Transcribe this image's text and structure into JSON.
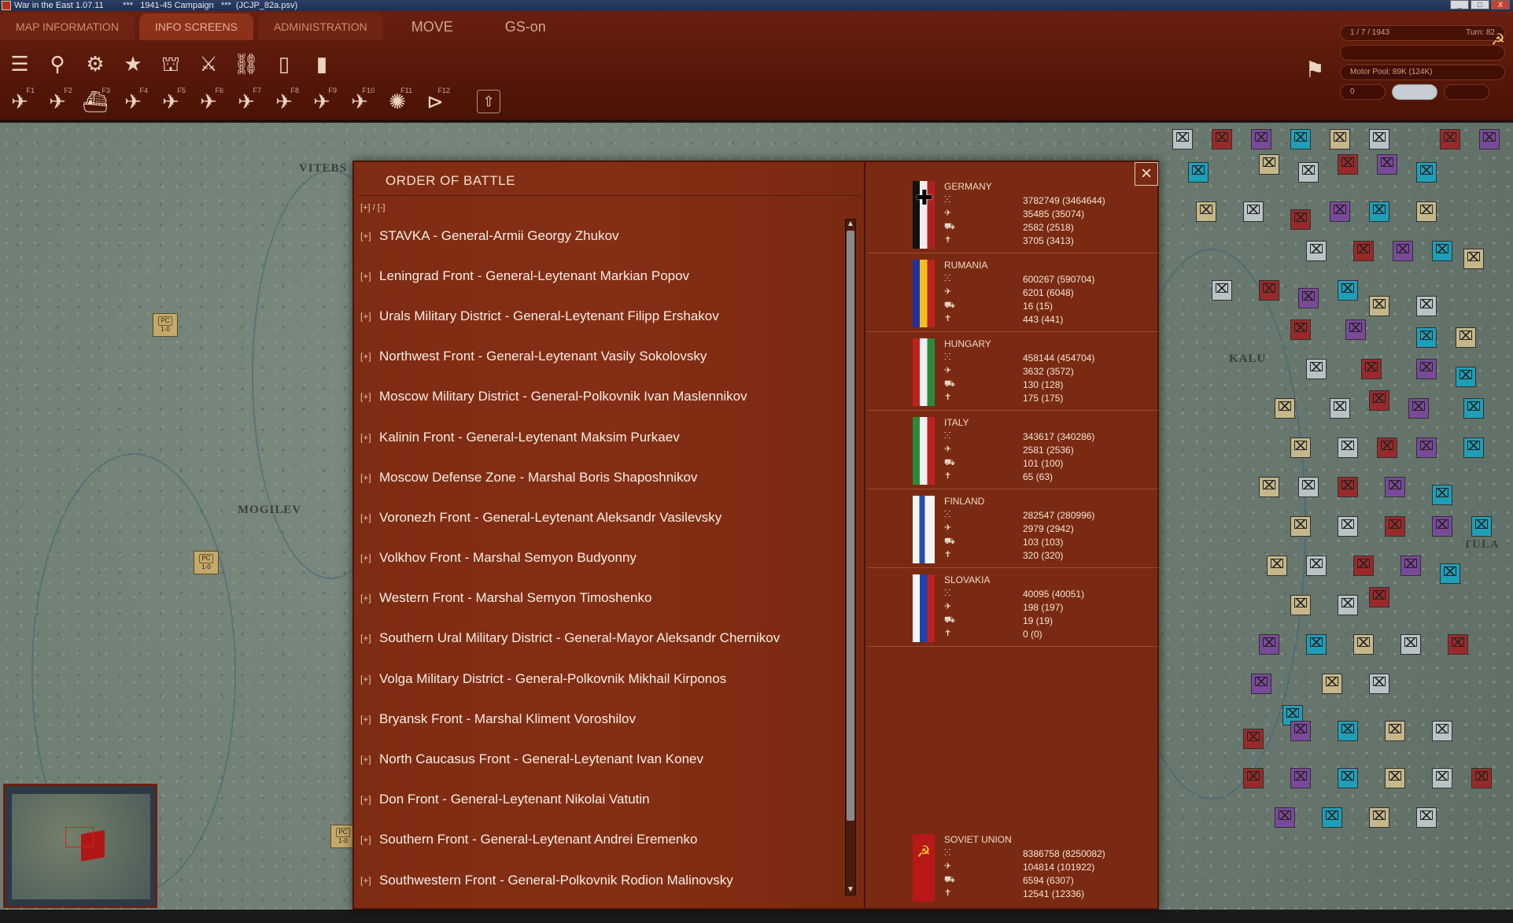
{
  "window": {
    "title": "War in the East 1.07.11        ***   1941-45 Campaign   ***  (JCJP_82a.psv)",
    "minimize": "_",
    "maximize": "□",
    "close": "X"
  },
  "menu": {
    "tabs": [
      "MAP INFORMATION",
      "INFO SCREENS",
      "ADMINISTRATION"
    ],
    "move_label": "MOVE",
    "gs_label": "GS-on"
  },
  "toolbar": {
    "row1": [
      {
        "name": "layers-icon",
        "glyph": "☰"
      },
      {
        "name": "sliders-icon",
        "glyph": "⚲"
      },
      {
        "name": "gear-icon",
        "glyph": "⚙"
      },
      {
        "name": "star-icon",
        "glyph": "★"
      },
      {
        "name": "fortification-icon",
        "glyph": "⛫"
      },
      {
        "name": "crossed-swords-icon",
        "glyph": "⚔"
      },
      {
        "name": "rail-icon",
        "glyph": "⛓"
      },
      {
        "name": "fuel-icon",
        "glyph": "▯"
      },
      {
        "name": "supply-icon",
        "glyph": "▮"
      }
    ],
    "row2": [
      {
        "name": "air-doctrine-icon",
        "glyph": "✈",
        "fkey": "F1"
      },
      {
        "name": "air-transport-icon",
        "glyph": "✈",
        "fkey": "F2"
      },
      {
        "name": "naval-icon",
        "glyph": "⛴",
        "fkey": "F3"
      },
      {
        "name": "airfield-icon",
        "glyph": "✈",
        "fkey": "F4"
      },
      {
        "name": "air-recon-icon",
        "glyph": "✈",
        "fkey": "F5"
      },
      {
        "name": "air-interdict-icon",
        "glyph": "✈",
        "fkey": "F6"
      },
      {
        "name": "air-strike-icon",
        "glyph": "✈",
        "fkey": "F7"
      },
      {
        "name": "air-bomb-icon",
        "glyph": "✈",
        "fkey": "F8"
      },
      {
        "name": "air-ground-icon",
        "glyph": "✈",
        "fkey": "F9"
      },
      {
        "name": "air-supply-icon",
        "glyph": "✈",
        "fkey": "F10"
      },
      {
        "name": "partisan-icon",
        "glyph": "✺",
        "fkey": "F11"
      },
      {
        "name": "play-icon",
        "glyph": "⊳",
        "fkey": "F12"
      },
      {
        "name": "upload-icon",
        "glyph": "⇧",
        "fkey": ""
      }
    ]
  },
  "status": {
    "date": "1 / 7 / 1943",
    "turn": "Turn: 82",
    "empty_field": "",
    "motor_pool": "Motor Pool:  89K (124K)",
    "counter": "0"
  },
  "map": {
    "cities": [
      "VITEBS",
      "MOGILEV",
      "KALU",
      "TULA"
    ],
    "pc_label": "PC",
    "pc_values": [
      "1-0",
      "1-0",
      "1-0"
    ]
  },
  "minimap": {},
  "oob": {
    "title": "ORDER OF BATTLE",
    "expand_all": "[+] / [-]",
    "close": "×",
    "items": [
      "STAVKA  -  General-Armii Georgy Zhukov",
      "Leningrad Front  -  General-Leytenant Markian Popov",
      "Urals Military District  -  General-Leytenant Filipp Ershakov",
      "Northwest Front  -  General-Leytenant Vasily Sokolovsky",
      "Moscow Military District  -  General-Polkovnik Ivan Maslennikov",
      "Kalinin Front  -  General-Leytenant Maksim Purkaev",
      "Moscow Defense Zone  -  Marshal Boris Shaposhnikov",
      "Voronezh Front  -  General-Leytenant Aleksandr Vasilevsky",
      "Volkhov Front  -  Marshal Semyon Budyonny",
      "Western Front  -  Marshal Semyon Timoshenko",
      "Southern Ural Military District  -  General-Mayor Aleksandr Chernikov",
      "Volga Military District  -  General-Polkovnik Mikhail Kirponos",
      "Bryansk Front  -  Marshal Kliment Voroshilov",
      "North Caucasus Front  -  General-Leytenant Ivan Konev",
      "Don Front  -  General-Leytenant Nikolai Vatutin",
      "Southern Front  -  General-Leytenant Andrei Eremenko",
      "Southwestern Front  -  General-Polkovnik Rodion Malinovsky"
    ],
    "item_prefix": "[+]",
    "scroll_up": "▲",
    "scroll_down": "▼",
    "stat_icons": [
      "manpower-icon",
      "aircraft-icon",
      "tank-icon",
      "artillery-icon"
    ],
    "nations": [
      {
        "name": "GERMANY",
        "flag": "germany",
        "stats": [
          "3782749 (3464644)",
          "35485 (35074)",
          "2582 (2518)",
          "3705 (3413)"
        ]
      },
      {
        "name": "RUMANIA",
        "flag": "romania",
        "stats": [
          "600267 (590704)",
          "6201 (6048)",
          "16 (15)",
          "443 (441)"
        ]
      },
      {
        "name": "HUNGARY",
        "flag": "hungary",
        "stats": [
          "458144 (454704)",
          "3632 (3572)",
          "130 (128)",
          "175 (175)"
        ]
      },
      {
        "name": "ITALY",
        "flag": "italy",
        "stats": [
          "343617 (340286)",
          "2581 (2536)",
          "101 (100)",
          "65 (63)"
        ]
      },
      {
        "name": "FINLAND",
        "flag": "finland",
        "stats": [
          "282547 (280996)",
          "2979 (2942)",
          "103 (103)",
          "320 (320)"
        ]
      },
      {
        "name": "SLOVAKIA",
        "flag": "slovakia",
        "stats": [
          "40095 (40051)",
          "198 (197)",
          "19 (19)",
          "0 (0)"
        ]
      },
      {
        "name": "SOVIET UNION",
        "flag": "soviet",
        "stats": [
          "8386758 (8250082)",
          "104814 (101922)",
          "6594 (6307)",
          "12541 (12336)"
        ]
      }
    ]
  }
}
